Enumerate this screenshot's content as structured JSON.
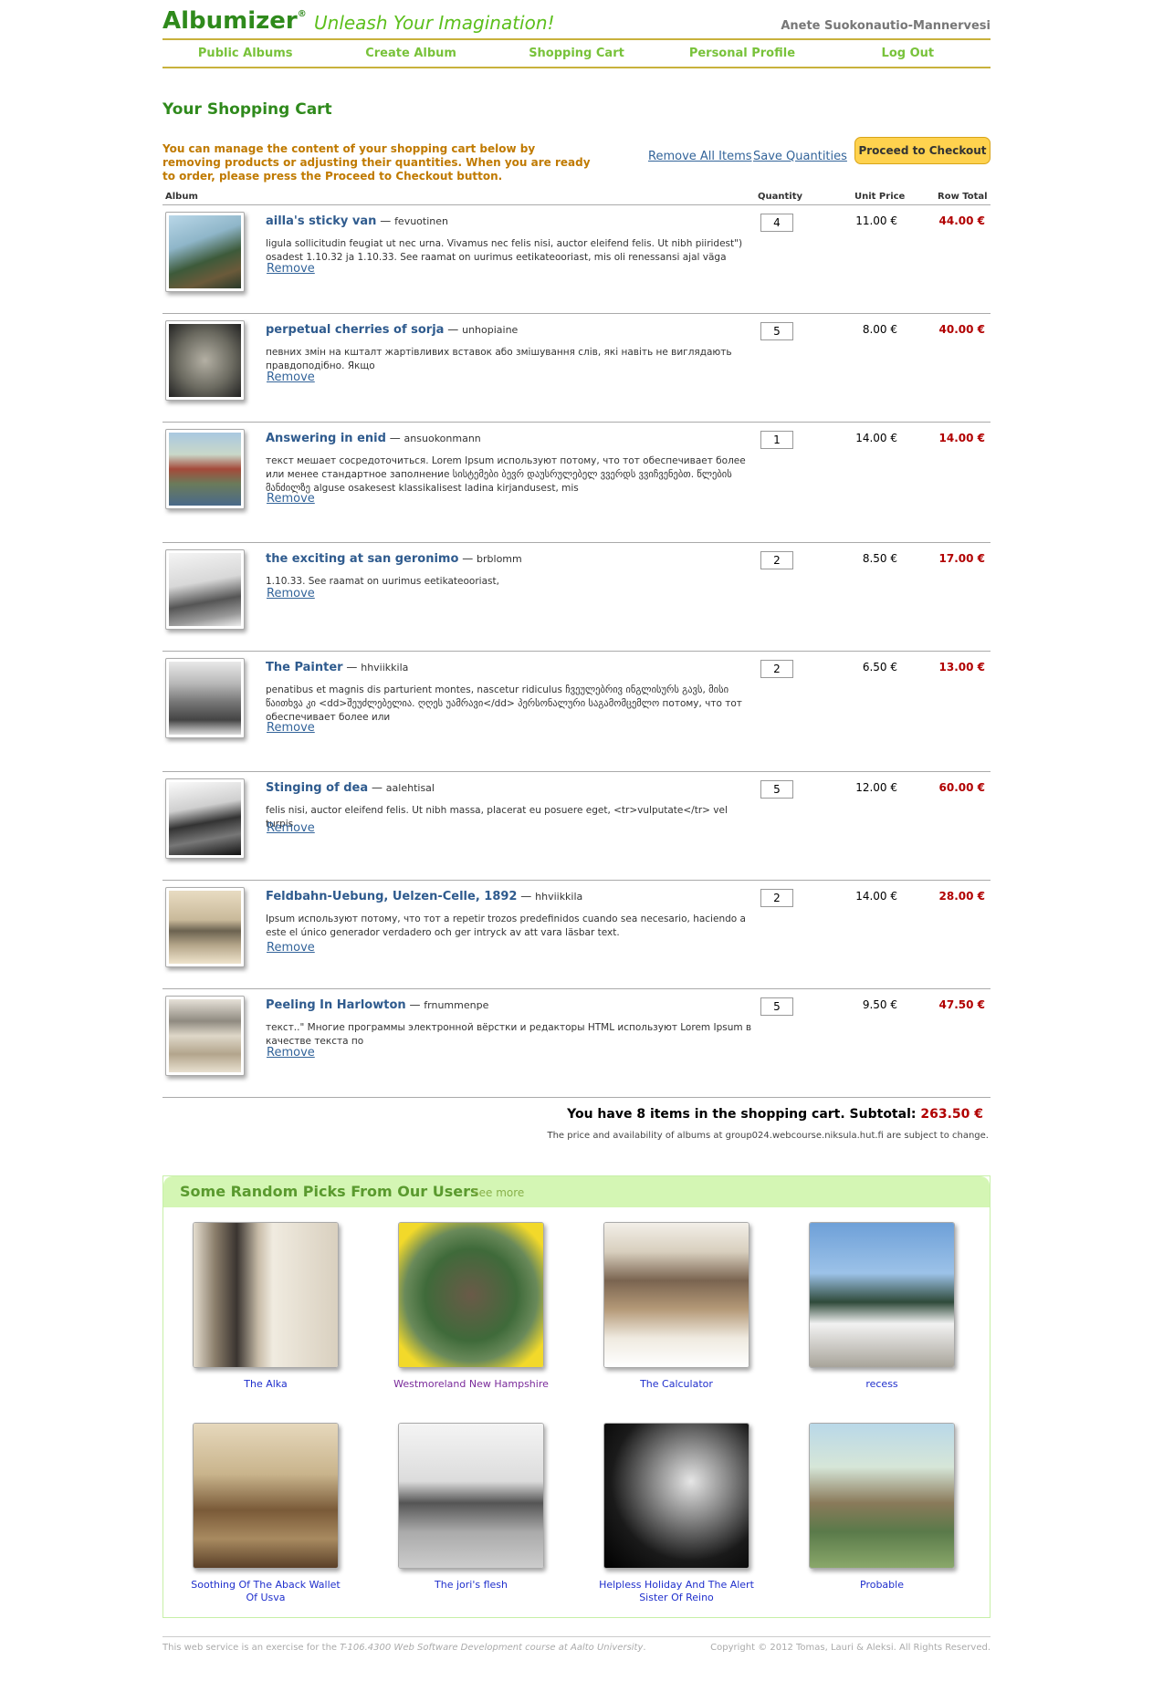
{
  "header": {
    "logo": "Albumizer",
    "logo_mark": "®",
    "tagline": "Unleash Your Imagination!",
    "username": "Anete Suokonautio-Mannervesi"
  },
  "nav": [
    "Public Albums",
    "Create Album",
    "Shopping Cart",
    "Personal Profile",
    "Log Out"
  ],
  "page_title": "Your Shopping Cart",
  "intro": "You can manage the content of your shopping cart below by removing products or adjusting their quantities. When you are ready to order, please press the Proceed to Checkout button.",
  "actions": {
    "remove_all": "Remove All Items",
    "save_quantities": "Save Quantities",
    "checkout": "Proceed to Checkout"
  },
  "columns": {
    "album": "Album",
    "quantity": "Quantity",
    "unit_price": "Unit Price",
    "row_total": "Row Total"
  },
  "items": [
    {
      "title": "ailla's sticky van",
      "owner": "fevuotinen",
      "description": "ligula sollicitudin feugiat ut nec urna. Vivamus nec felis nisi, auctor eleifend felis. Ut nibh piiridest\") osadest 1.10.32 ja 1.10.33. See raamat on uurimus eetikateooriast, mis oli renessansi ajal väga",
      "quantity": "4",
      "unit_price": "11.00 €",
      "row_total": "44.00 €",
      "remove": "Remove"
    },
    {
      "title": "perpetual cherries of sorja",
      "owner": "unhopiaine",
      "description": "певних змін на кшталт жартівливих вставок або змішування слів, які навіть не виглядають правдоподібно. Якщо",
      "quantity": "5",
      "unit_price": "8.00 €",
      "row_total": "40.00 €",
      "remove": "Remove"
    },
    {
      "title": "Answering in enid",
      "owner": "ansuokonmann",
      "description": "текст мешает сосредоточиться. Lorem Ipsum используют потому, что тот обеспечивает более или менее стандартное заполнение სისტემები ბევრ დაუსრულებელ ვვერდს ვვიჩვენებთ. წლების მანძილზე alguse osakesest klassikalisest ladina kirjandusest, mis",
      "quantity": "1",
      "unit_price": "14.00 €",
      "row_total": "14.00 €",
      "remove": "Remove"
    },
    {
      "title": "the exciting at san geronimo",
      "owner": "brblomm",
      "description": "1.10.33. See raamat on uurimus eetikateooriast,",
      "quantity": "2",
      "unit_price": "8.50 €",
      "row_total": "17.00 €",
      "remove": "Remove"
    },
    {
      "title": "The Painter",
      "owner": "hhviikkila",
      "description": "penatibus et magnis dis parturient montes, nascetur ridiculus ჩვეულებრივ ინგლისურს გავს, მისი წაითხვა კი <dd>შეუძლებელია. ღღეს უამრავი</dd> პერსონალური საგამომცემლო потому, что тот обеспечивает более или",
      "quantity": "2",
      "unit_price": "6.50 €",
      "row_total": "13.00 €",
      "remove": "Remove"
    },
    {
      "title": "Stinging of dea",
      "owner": "aalehtisal",
      "description": "felis nisi, auctor eleifend felis. Ut nibh massa, placerat eu posuere eget, <tr>vulputate</tr> vel turpis.",
      "quantity": "5",
      "unit_price": "12.00 €",
      "row_total": "60.00 €",
      "remove": "Remove"
    },
    {
      "title": "Feldbahn-Uebung, Uelzen-Celle, 1892",
      "owner": "hhviikkila",
      "description": "Ipsum используют потому, что тот a repetir trozos predefinidos cuando sea necesario, haciendo a este el único generador verdadero och ger intryck av att vara läsbar text.",
      "quantity": "2",
      "unit_price": "14.00 €",
      "row_total": "28.00 €",
      "remove": "Remove"
    },
    {
      "title": "Peeling In Harlowton",
      "owner": "frnummenpe",
      "description": "текст..\" Многие программы электронной вёрстки и редакторы HTML используют Lorem Ipsum в качестве текста по",
      "quantity": "5",
      "unit_price": "9.50 €",
      "row_total": "47.50 €",
      "remove": "Remove"
    }
  ],
  "summary": {
    "text": "You have 8 items in the shopping cart. Subtotal:",
    "amount": "263.50 €",
    "note": "The price and availability of albums at group024.webcourse.niksula.hut.fi are subject to change."
  },
  "picks": {
    "title": "Some Random Picks From Our Users",
    "see_more": "See more",
    "items": [
      {
        "label": "The Alka"
      },
      {
        "label": "Westmoreland New Hampshire"
      },
      {
        "label": "The Calculator"
      },
      {
        "label": "recess"
      },
      {
        "label": "Soothing Of The Aback Wallet Of Usva"
      },
      {
        "label": "The jori's flesh"
      },
      {
        "label": "Helpless Holiday And The Alert Sister Of Reino"
      },
      {
        "label": "Probable"
      }
    ]
  },
  "footer": {
    "left_prefix": "This web service is an exercise for the ",
    "left_course": "T-106.4300 Web Software Development course at Aalto University",
    "left_suffix": ".",
    "right": "Copyright © 2012 Tomas, Lauri & Aleksi. All Rights Reserved."
  }
}
